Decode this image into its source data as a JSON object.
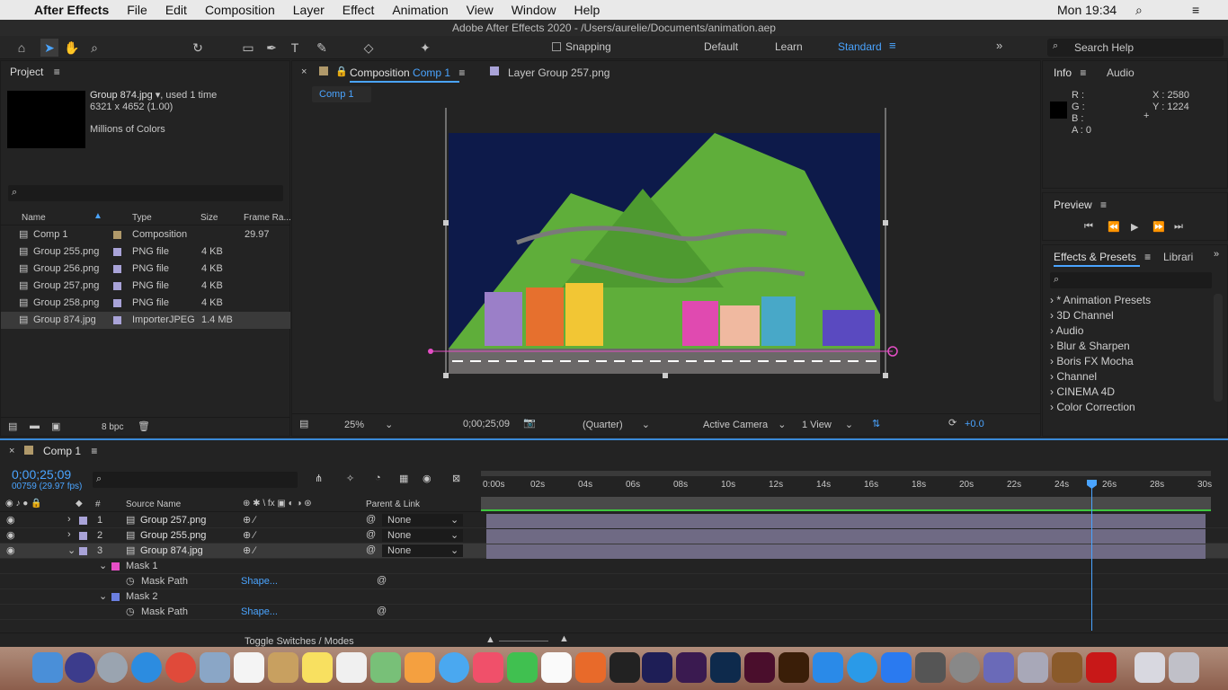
{
  "menubar": {
    "app": "After Effects",
    "items": [
      "File",
      "Edit",
      "Composition",
      "Layer",
      "Effect",
      "Animation",
      "View",
      "Window",
      "Help"
    ],
    "clock": "Mon 19:34"
  },
  "window_title": "Adobe After Effects 2020 - /Users/aurelie/Documents/animation.aep",
  "toolbar": {
    "snapping": "Snapping",
    "workspaces": [
      "Default",
      "Learn",
      "Standard"
    ],
    "search": "Search Help"
  },
  "project": {
    "title": "Project",
    "info_name": "Group 874.jpg",
    "info_used": ", used 1 time",
    "info_dims": "6321 x 4652 (1.00)",
    "info_colors": "Millions of Colors",
    "columns": [
      "Name",
      "Type",
      "Size",
      "Frame Ra..."
    ],
    "items": [
      {
        "name": "Comp 1",
        "type": "Composition",
        "size": "",
        "fr": "29.97",
        "color": "#b0996a"
      },
      {
        "name": "Group 255.png",
        "type": "PNG file",
        "size": "4 KB",
        "fr": "",
        "color": "#a9a3d8"
      },
      {
        "name": "Group 256.png",
        "type": "PNG file",
        "size": "4 KB",
        "fr": "",
        "color": "#a9a3d8"
      },
      {
        "name": "Group 257.png",
        "type": "PNG file",
        "size": "4 KB",
        "fr": "",
        "color": "#a9a3d8"
      },
      {
        "name": "Group 258.png",
        "type": "PNG file",
        "size": "4 KB",
        "fr": "",
        "color": "#a9a3d8"
      },
      {
        "name": "Group 874.jpg",
        "type": "ImporterJPEG",
        "size": "1.4 MB",
        "fr": "",
        "color": "#a9a3d8"
      }
    ],
    "bpc": "8 bpc"
  },
  "viewer": {
    "tab_prefix": "Composition",
    "tab_comp": "Comp 1",
    "layer_tab": "Layer Group 257.png",
    "breadcrumb": "Comp 1",
    "zoom": "25%",
    "timecode": "0;00;25;09",
    "resolution": "(Quarter)",
    "camera": "Active Camera",
    "views": "1 View",
    "exposure": "+0.0"
  },
  "info": {
    "title": "Info",
    "audio": "Audio",
    "r": "R :",
    "g": "G :",
    "b": "B :",
    "a": "A : 0",
    "x": "X : 2580",
    "y": "Y : 1224"
  },
  "preview": {
    "title": "Preview"
  },
  "effects": {
    "title": "Effects & Presets",
    "libraries": "Librari",
    "items": [
      "* Animation Presets",
      "3D Channel",
      "Audio",
      "Blur & Sharpen",
      "Boris FX Mocha",
      "Channel",
      "CINEMA 4D",
      "Color Correction"
    ]
  },
  "timeline": {
    "comp": "Comp 1",
    "timecode": "0;00;25;09",
    "frames": "00759 (29.97 fps)",
    "headers": {
      "num": "#",
      "source": "Source Name",
      "parent": "Parent & Link"
    },
    "ruler": [
      "0:00s",
      "02s",
      "04s",
      "06s",
      "08s",
      "10s",
      "12s",
      "14s",
      "16s",
      "18s",
      "20s",
      "22s",
      "24s",
      "26s",
      "28s",
      "30s"
    ],
    "layers": [
      {
        "num": "1",
        "name": "Group 257.png",
        "parent": "None"
      },
      {
        "num": "2",
        "name": "Group 255.png",
        "parent": "None"
      },
      {
        "num": "3",
        "name": "Group 874.jpg",
        "parent": "None"
      }
    ],
    "masks": [
      {
        "name": "Mask 1",
        "prop": "Mask Path",
        "value": "Shape...",
        "color": "#e54ec6"
      },
      {
        "name": "Mask 2",
        "prop": "Mask Path",
        "value": "Shape...",
        "color": "#6b7fe0"
      }
    ],
    "toggle": "Toggle Switches / Modes"
  },
  "colors": {
    "accent": "#4aa4ff",
    "sky": "#0d1a4a",
    "hill": "#5fae3a"
  }
}
